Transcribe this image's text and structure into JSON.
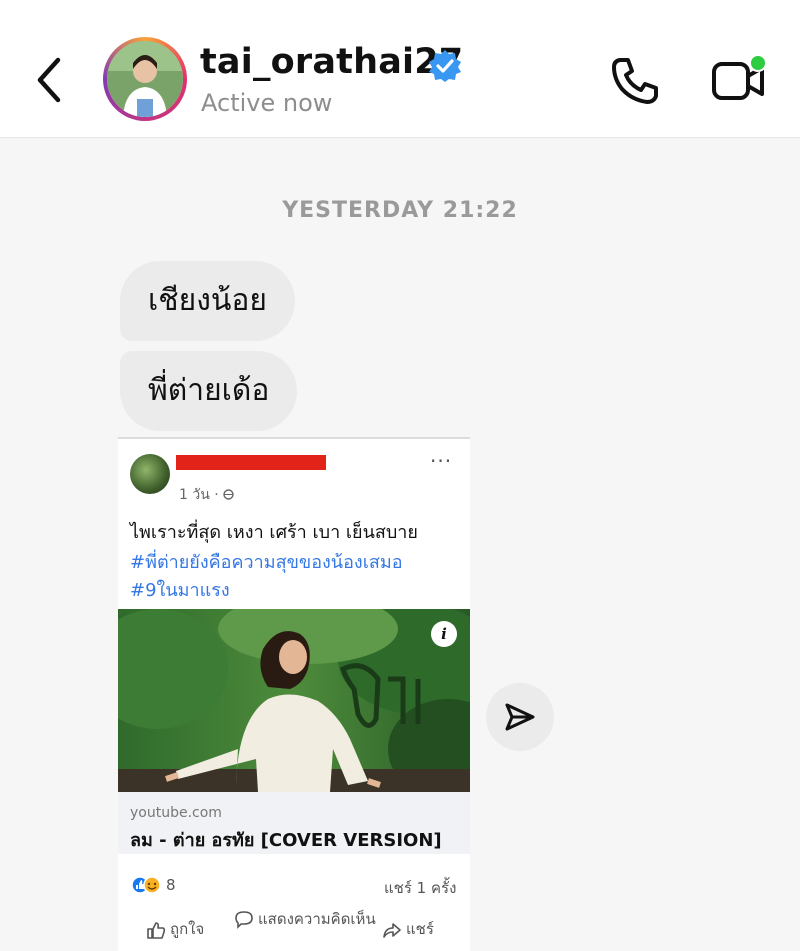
{
  "header": {
    "username": "tai_orathai27",
    "status": "Active now",
    "icons": {
      "back": "back-chevron-icon",
      "verified": "verified-badge-icon",
      "call": "phone-icon",
      "video": "video-call-icon"
    },
    "colors": {
      "verified": "#3897f0",
      "online_dot": "#2ecc40"
    }
  },
  "thread": {
    "timestamp": "YESTERDAY 21:22",
    "messages": [
      {
        "text": "เชียงน้อย"
      },
      {
        "text": "พี่ต่ายเด้อ"
      }
    ]
  },
  "shared_post": {
    "time": "1 วัน · ",
    "more_label": "···",
    "caption": "ไพเราะที่สุด เหงา เศร้า เบา เย็นสบาย",
    "hashtags": [
      "#พี่ต่ายยังคือความสุขของน้องเสมอ",
      "#9ในมาแรง"
    ],
    "thumbnail_info": "i",
    "link_domain": "youtube.com",
    "link_title": "ลม - ต่าย อรทัย [COVER VERSION]",
    "reaction_count": "8",
    "share_count": "แชร์ 1 ครั้ง",
    "actions": {
      "like": "ถูกใจ",
      "comment": "แสดงความคิดเห็น",
      "share": "แชร์"
    },
    "colors": {
      "hashtag": "#3578e5",
      "redaction": "#e2231a"
    }
  },
  "forward": {
    "icon": "send-icon"
  }
}
